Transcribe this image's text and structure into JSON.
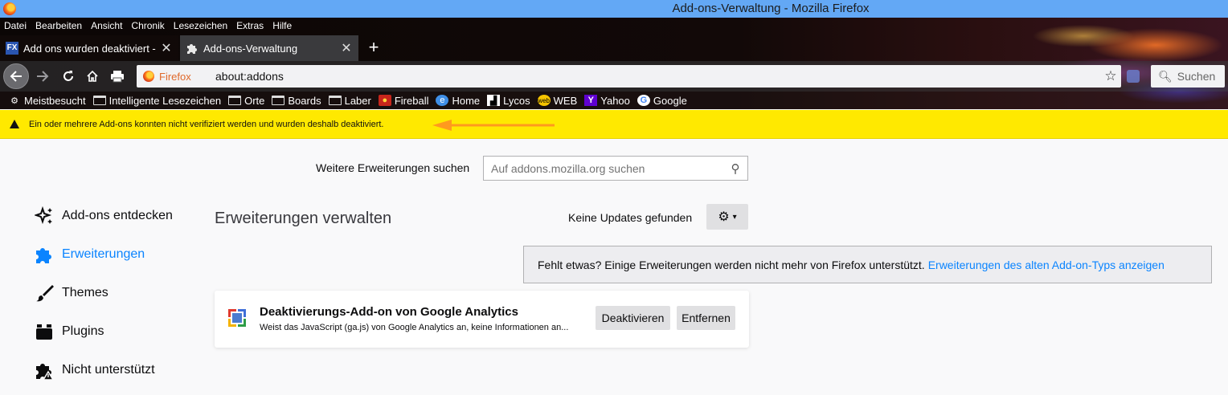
{
  "window": {
    "title": "Add-ons-Verwaltung - Mozilla Firefox"
  },
  "menubar": [
    "Datei",
    "Bearbeiten",
    "Ansicht",
    "Chronik",
    "Lesezeichen",
    "Extras",
    "Hilfe"
  ],
  "tabs": [
    {
      "label": "Add ons wurden deaktiviert - So",
      "icon": "fx-site-icon",
      "active": false
    },
    {
      "label": "Add-ons-Verwaltung",
      "icon": "puzzle-icon",
      "active": true
    }
  ],
  "navbar": {
    "identity_label": "Firefox",
    "url": "about:addons",
    "search_placeholder": "Suchen"
  },
  "bookmarks": [
    {
      "label": "Meistbesucht",
      "icon": "gear-icon"
    },
    {
      "label": "Intelligente Lesezeichen",
      "icon": "folder-icon"
    },
    {
      "label": "Orte",
      "icon": "folder-icon"
    },
    {
      "label": "Boards",
      "icon": "folder-icon"
    },
    {
      "label": "Laber",
      "icon": "folder-icon"
    },
    {
      "label": "Fireball",
      "icon": "fireball-icon"
    },
    {
      "label": "Home",
      "icon": "home-site-icon"
    },
    {
      "label": "Lycos",
      "icon": "lycos-icon"
    },
    {
      "label": "WEB",
      "icon": "web-icon"
    },
    {
      "label": "Yahoo",
      "icon": "yahoo-icon"
    },
    {
      "label": "Google",
      "icon": "google-icon"
    }
  ],
  "notification": {
    "text": "Ein oder mehrere Add-ons konnten nicht verifiziert werden und wurden deshalb deaktiviert."
  },
  "search": {
    "label": "Weitere Erweiterungen suchen",
    "placeholder": "Auf addons.mozilla.org suchen"
  },
  "sidebar": {
    "items": [
      {
        "label": "Add-ons entdecken",
        "icon": "discover-icon",
        "active": false
      },
      {
        "label": "Erweiterungen",
        "icon": "puzzle-icon",
        "active": true
      },
      {
        "label": "Themes",
        "icon": "brush-icon",
        "active": false
      },
      {
        "label": "Plugins",
        "icon": "plugin-icon",
        "active": false
      },
      {
        "label": "Nicht unterstützt",
        "icon": "unsupported-puzzle-icon",
        "active": false
      }
    ]
  },
  "main": {
    "title": "Erweiterungen verwalten",
    "updates_status": "Keine Updates gefunden",
    "legacy_notice": "Fehlt etwas? Einige Erweiterungen werden nicht mehr von Firefox unterstützt.",
    "legacy_link": "Erweiterungen des alten Add-on-Typs anzeigen",
    "addons": [
      {
        "name": "Deaktivierungs-Add-on von Google Analytics",
        "description": "Weist das JavaScript (ga.js) von Google Analytics an, keine Informationen an...",
        "disable_label": "Deaktivieren",
        "remove_label": "Entfernen"
      }
    ]
  },
  "colors": {
    "accent": "#0a84ff",
    "notice_bg": "#ffe900",
    "arrow": "#ff9a1e"
  }
}
